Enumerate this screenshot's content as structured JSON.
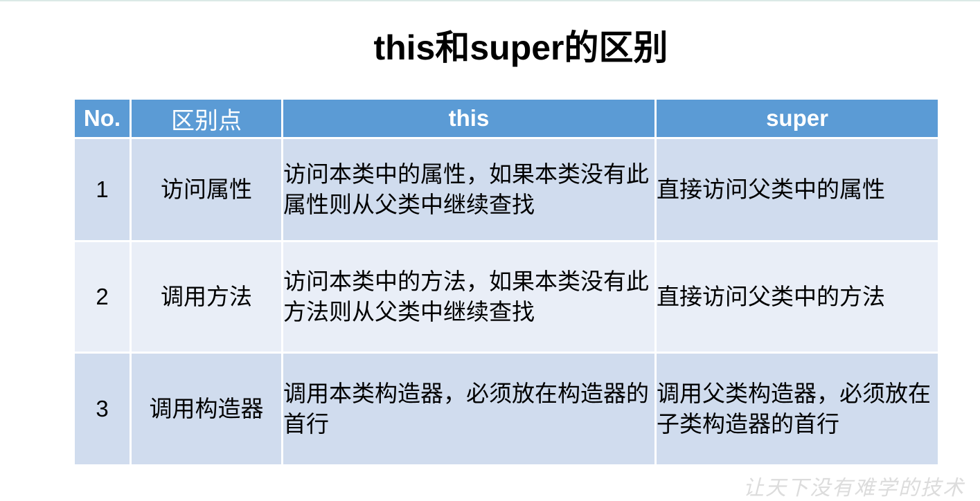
{
  "title": "this和super的区别",
  "table": {
    "headers": [
      "No.",
      "区别点",
      "this",
      "super"
    ],
    "rows": [
      {
        "no": "1",
        "point": "访问属性",
        "this": "访问本类中的属性，如果本类没有此属性则从父类中继续查找",
        "super": "直接访问父类中的属性"
      },
      {
        "no": "2",
        "point": "调用方法",
        "this": "访问本类中的方法，如果本类没有此方法则从父类中继续查找",
        "super": "直接访问父类中的方法"
      },
      {
        "no": "3",
        "point": "调用构造器",
        "this": "调用本类构造器，必须放在构造器的首行",
        "super": "调用父类构造器，必须放在子类构造器的首行"
      }
    ]
  },
  "watermark": "让天下没有难学的技术",
  "colors": {
    "header_bg": "#5b9bd5",
    "row_odd_bg": "#d0dcee",
    "row_even_bg": "#e9eef7"
  }
}
